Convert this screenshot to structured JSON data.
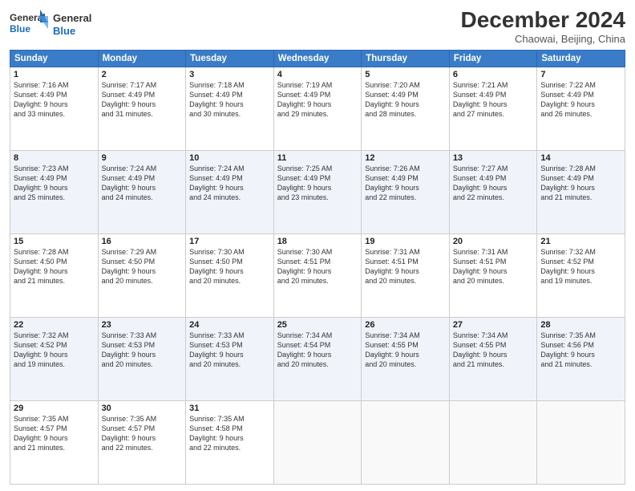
{
  "header": {
    "logo_line1": "General",
    "logo_line2": "Blue",
    "month": "December 2024",
    "location": "Chaowai, Beijing, China"
  },
  "weekdays": [
    "Sunday",
    "Monday",
    "Tuesday",
    "Wednesday",
    "Thursday",
    "Friday",
    "Saturday"
  ],
  "weeks": [
    [
      {
        "day": "1",
        "text": "Sunrise: 7:16 AM\nSunset: 4:49 PM\nDaylight: 9 hours\nand 33 minutes."
      },
      {
        "day": "2",
        "text": "Sunrise: 7:17 AM\nSunset: 4:49 PM\nDaylight: 9 hours\nand 31 minutes."
      },
      {
        "day": "3",
        "text": "Sunrise: 7:18 AM\nSunset: 4:49 PM\nDaylight: 9 hours\nand 30 minutes."
      },
      {
        "day": "4",
        "text": "Sunrise: 7:19 AM\nSunset: 4:49 PM\nDaylight: 9 hours\nand 29 minutes."
      },
      {
        "day": "5",
        "text": "Sunrise: 7:20 AM\nSunset: 4:49 PM\nDaylight: 9 hours\nand 28 minutes."
      },
      {
        "day": "6",
        "text": "Sunrise: 7:21 AM\nSunset: 4:49 PM\nDaylight: 9 hours\nand 27 minutes."
      },
      {
        "day": "7",
        "text": "Sunrise: 7:22 AM\nSunset: 4:49 PM\nDaylight: 9 hours\nand 26 minutes."
      }
    ],
    [
      {
        "day": "8",
        "text": "Sunrise: 7:23 AM\nSunset: 4:49 PM\nDaylight: 9 hours\nand 25 minutes."
      },
      {
        "day": "9",
        "text": "Sunrise: 7:24 AM\nSunset: 4:49 PM\nDaylight: 9 hours\nand 24 minutes."
      },
      {
        "day": "10",
        "text": "Sunrise: 7:24 AM\nSunset: 4:49 PM\nDaylight: 9 hours\nand 24 minutes."
      },
      {
        "day": "11",
        "text": "Sunrise: 7:25 AM\nSunset: 4:49 PM\nDaylight: 9 hours\nand 23 minutes."
      },
      {
        "day": "12",
        "text": "Sunrise: 7:26 AM\nSunset: 4:49 PM\nDaylight: 9 hours\nand 22 minutes."
      },
      {
        "day": "13",
        "text": "Sunrise: 7:27 AM\nSunset: 4:49 PM\nDaylight: 9 hours\nand 22 minutes."
      },
      {
        "day": "14",
        "text": "Sunrise: 7:28 AM\nSunset: 4:49 PM\nDaylight: 9 hours\nand 21 minutes."
      }
    ],
    [
      {
        "day": "15",
        "text": "Sunrise: 7:28 AM\nSunset: 4:50 PM\nDaylight: 9 hours\nand 21 minutes."
      },
      {
        "day": "16",
        "text": "Sunrise: 7:29 AM\nSunset: 4:50 PM\nDaylight: 9 hours\nand 20 minutes."
      },
      {
        "day": "17",
        "text": "Sunrise: 7:30 AM\nSunset: 4:50 PM\nDaylight: 9 hours\nand 20 minutes."
      },
      {
        "day": "18",
        "text": "Sunrise: 7:30 AM\nSunset: 4:51 PM\nDaylight: 9 hours\nand 20 minutes."
      },
      {
        "day": "19",
        "text": "Sunrise: 7:31 AM\nSunset: 4:51 PM\nDaylight: 9 hours\nand 20 minutes."
      },
      {
        "day": "20",
        "text": "Sunrise: 7:31 AM\nSunset: 4:51 PM\nDaylight: 9 hours\nand 20 minutes."
      },
      {
        "day": "21",
        "text": "Sunrise: 7:32 AM\nSunset: 4:52 PM\nDaylight: 9 hours\nand 19 minutes."
      }
    ],
    [
      {
        "day": "22",
        "text": "Sunrise: 7:32 AM\nSunset: 4:52 PM\nDaylight: 9 hours\nand 19 minutes."
      },
      {
        "day": "23",
        "text": "Sunrise: 7:33 AM\nSunset: 4:53 PM\nDaylight: 9 hours\nand 20 minutes."
      },
      {
        "day": "24",
        "text": "Sunrise: 7:33 AM\nSunset: 4:53 PM\nDaylight: 9 hours\nand 20 minutes."
      },
      {
        "day": "25",
        "text": "Sunrise: 7:34 AM\nSunset: 4:54 PM\nDaylight: 9 hours\nand 20 minutes."
      },
      {
        "day": "26",
        "text": "Sunrise: 7:34 AM\nSunset: 4:55 PM\nDaylight: 9 hours\nand 20 minutes."
      },
      {
        "day": "27",
        "text": "Sunrise: 7:34 AM\nSunset: 4:55 PM\nDaylight: 9 hours\nand 21 minutes."
      },
      {
        "day": "28",
        "text": "Sunrise: 7:35 AM\nSunset: 4:56 PM\nDaylight: 9 hours\nand 21 minutes."
      }
    ],
    [
      {
        "day": "29",
        "text": "Sunrise: 7:35 AM\nSunset: 4:57 PM\nDaylight: 9 hours\nand 21 minutes."
      },
      {
        "day": "30",
        "text": "Sunrise: 7:35 AM\nSunset: 4:57 PM\nDaylight: 9 hours\nand 22 minutes."
      },
      {
        "day": "31",
        "text": "Sunrise: 7:35 AM\nSunset: 4:58 PM\nDaylight: 9 hours\nand 22 minutes."
      },
      null,
      null,
      null,
      null
    ]
  ]
}
